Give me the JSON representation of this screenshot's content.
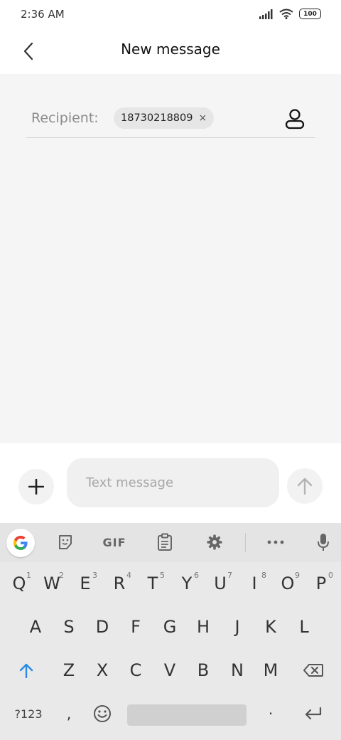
{
  "status": {
    "time": "2:36 AM",
    "battery": "100"
  },
  "header": {
    "title": "New message"
  },
  "recipient": {
    "label": "Recipient:",
    "chip": "18730218809",
    "chip_close": "×"
  },
  "composer": {
    "placeholder": "Text message"
  },
  "keyboard": {
    "toolbar": {
      "gif": "GIF"
    },
    "row1": [
      {
        "k": "Q",
        "h": "1"
      },
      {
        "k": "W",
        "h": "2"
      },
      {
        "k": "E",
        "h": "3"
      },
      {
        "k": "R",
        "h": "4"
      },
      {
        "k": "T",
        "h": "5"
      },
      {
        "k": "Y",
        "h": "6"
      },
      {
        "k": "U",
        "h": "7"
      },
      {
        "k": "I",
        "h": "8"
      },
      {
        "k": "O",
        "h": "9"
      },
      {
        "k": "P",
        "h": "0"
      }
    ],
    "row2": [
      "A",
      "S",
      "D",
      "F",
      "G",
      "H",
      "J",
      "K",
      "L"
    ],
    "row3": [
      "Z",
      "X",
      "C",
      "V",
      "B",
      "N",
      "M"
    ],
    "symbols_label": "?123",
    "comma": ",",
    "period": "·"
  },
  "colors": {
    "accent": "#2b8be6",
    "content_bg": "#f5f5f5",
    "keyboard_bg": "#e9e9e9"
  }
}
